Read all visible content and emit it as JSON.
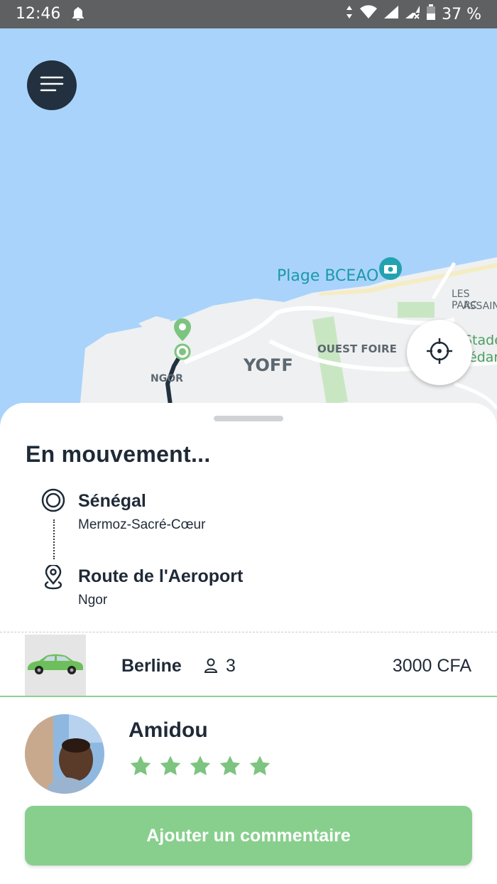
{
  "status_bar": {
    "time": "12:46",
    "battery": "37 %"
  },
  "map": {
    "labels": {
      "beach": "Plage BCEAO",
      "les_parc": "LES PARC",
      "assain": "ASSAIN",
      "stade": "Stade",
      "senedar": "édar",
      "ouest_foire": "OUEST FOIRE",
      "yoff": "YOFF",
      "ngor": "NGOR"
    }
  },
  "trip": {
    "status_title": "En mouvement...",
    "origin": {
      "name": "Sénégal",
      "address": "Mermoz-Sacré-Cœur"
    },
    "destination": {
      "name": "Route de l'Aeroport",
      "address": "Ngor"
    }
  },
  "vehicle": {
    "type": "Berline",
    "seats": "3",
    "price": "3000 CFA"
  },
  "driver": {
    "name": "Amidou",
    "rating": 5
  },
  "actions": {
    "comment_label": "Ajouter un commentaire"
  },
  "colors": {
    "accent": "#88cf8d",
    "dark": "#22303f",
    "water": "#aad3fb",
    "land": "#eef0f1"
  }
}
